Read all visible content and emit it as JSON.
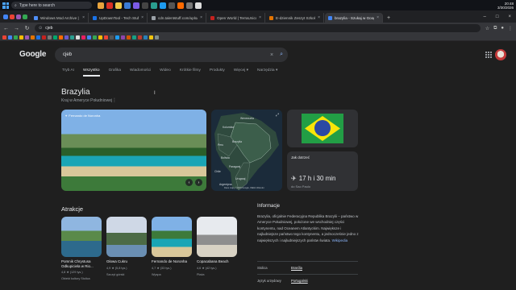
{
  "taskbar": {
    "search_placeholder": "Type here to search",
    "clock_time": "20:48",
    "clock_date": "3/30/2026"
  },
  "tabs": [
    {
      "title": "Windows Mod Archive | Free D",
      "color": "#4f8ff7"
    },
    {
      "title": "UpDownTool - Tech Stuff",
      "color": "#1a73e8"
    },
    {
      "title": "cdn.talentstuff.com/uploads/LL",
      "color": "#9aa0a6"
    },
    {
      "title": "Open World | TerraUnicos",
      "color": "#c5221f"
    },
    {
      "title": "E-dziennik Zeszyt Szkoł Techni",
      "color": "#e37400"
    },
    {
      "title": "brazylia - Szukaj w Google",
      "color": "#4285f4",
      "active": true
    }
  ],
  "address_bar": {
    "url": "cjeb"
  },
  "google": {
    "logo": "Google",
    "query": "cjeb",
    "filters": [
      "Tryb AI",
      "Wszystko",
      "Grafika",
      "Wiadomości",
      "Wideo",
      "Krótkie filmy",
      "Produkty",
      "Więcej",
      "Narzędzia"
    ],
    "active_filter": "Wszystko"
  },
  "knowledge_panel": {
    "title": "Brazylia",
    "subtitle": "Kraj w Ameryce Południowej",
    "photo_label": "Fernando de Noronha",
    "map_labels": [
      "Wenezuela",
      "Kolumbia",
      "Peru",
      "Brazylia",
      "Boliwia",
      "Chile",
      "Paragwaj",
      "Argentyna",
      "Urugwaj"
    ],
    "map_credit": "Dane mapy ©2025 Google, INEGI Warunki",
    "travel": {
      "heading": "Jak dotrzeć",
      "duration": "17 h i 30 min",
      "from": "do Sao Paulo"
    }
  },
  "attractions": {
    "heading": "Atrakcje",
    "items": [
      {
        "name": "Pomnik Chrystusa Odkupiciela w Rio...",
        "rating": "4,8 ★ (129 tys.)",
        "extra": "Obiekt kultury Stolica"
      },
      {
        "name": "Głowa Cukru",
        "rating": "4,9 ★ (5,8 tys.)",
        "extra": "Szczyt górski"
      },
      {
        "name": "Fernando de Noronha",
        "rating": "4,7 ★ (33 tys.)",
        "extra": "Wyspa"
      },
      {
        "name": "Copacabana Beach",
        "rating": "4,6 ★ (42 tys.)",
        "extra": "Plaża"
      }
    ]
  },
  "info": {
    "heading": "Informacje",
    "text": "Brazylia, oficjalnie Federacyjna Republika Brazylii – państwo w Ameryce Południowej, położone we wschodniej części kontynentu, nad Oceanem Atlantyckim. Największe i najludniejsze państwo tego kontynentu, a jednocześnie jedno z największych i najludniejszych państw świata.",
    "wiki_label": "Wikipedia",
    "rows": [
      {
        "key": "Stolica",
        "value": "Brasília"
      },
      {
        "key": "Język urzędowy",
        "value": "Portugalski"
      }
    ]
  }
}
